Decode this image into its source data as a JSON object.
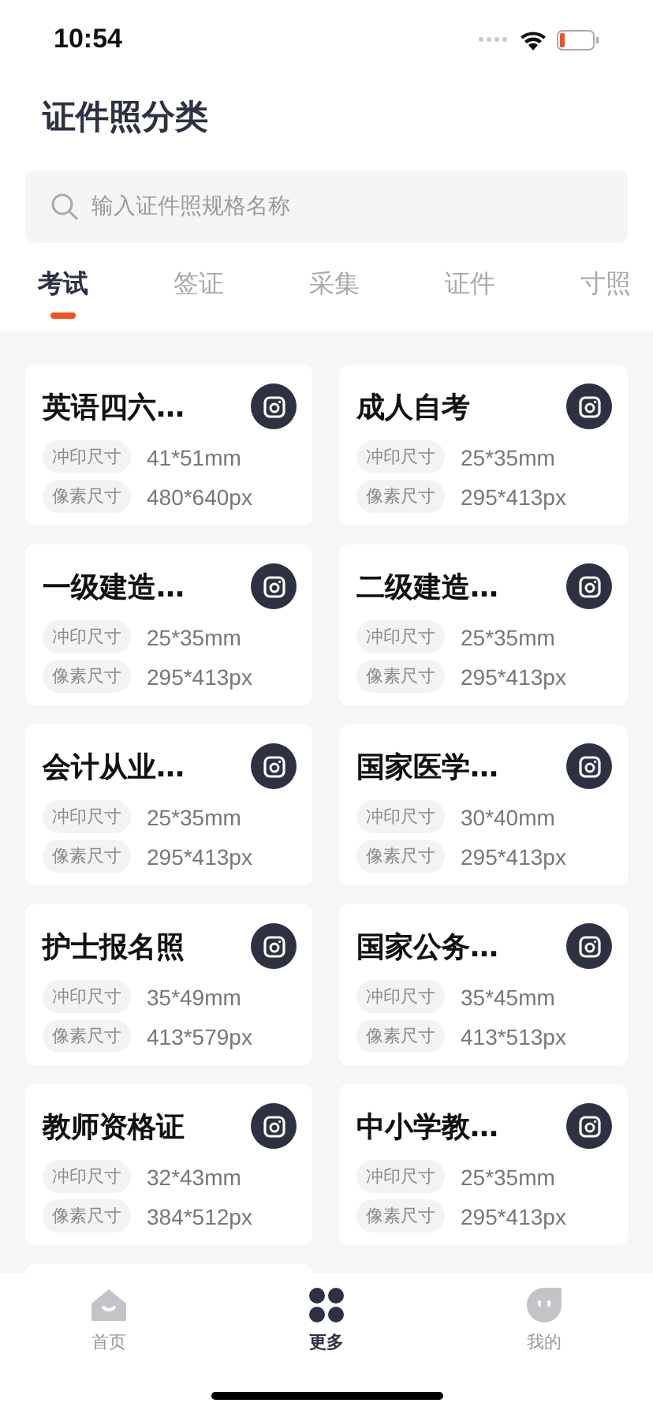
{
  "status_bar": {
    "time": "10:54"
  },
  "header": {
    "title": "证件照分类"
  },
  "search": {
    "placeholder": "输入证件照规格名称"
  },
  "tabs": [
    {
      "label": "考试",
      "selected": true
    },
    {
      "label": "签证",
      "selected": false
    },
    {
      "label": "采集",
      "selected": false
    },
    {
      "label": "证件",
      "selected": false
    },
    {
      "label": "寸照",
      "selected": false
    }
  ],
  "cards": [
    {
      "title": "英语四六…",
      "print_label": "冲印尺寸",
      "print_size": "41*51mm",
      "pixel_label": "像素尺寸",
      "pixel_size": "480*640px"
    },
    {
      "title": "成人自考",
      "print_label": "冲印尺寸",
      "print_size": "25*35mm",
      "pixel_label": "像素尺寸",
      "pixel_size": "295*413px"
    },
    {
      "title": "一级建造…",
      "print_label": "冲印尺寸",
      "print_size": "25*35mm",
      "pixel_label": "像素尺寸",
      "pixel_size": "295*413px"
    },
    {
      "title": "二级建造…",
      "print_label": "冲印尺寸",
      "print_size": "25*35mm",
      "pixel_label": "像素尺寸",
      "pixel_size": "295*413px"
    },
    {
      "title": "会计从业…",
      "print_label": "冲印尺寸",
      "print_size": "25*35mm",
      "pixel_label": "像素尺寸",
      "pixel_size": "295*413px"
    },
    {
      "title": "国家医学…",
      "print_label": "冲印尺寸",
      "print_size": "30*40mm",
      "pixel_label": "像素尺寸",
      "pixel_size": "295*413px"
    },
    {
      "title": "护士报名照",
      "print_label": "冲印尺寸",
      "print_size": "35*49mm",
      "pixel_label": "像素尺寸",
      "pixel_size": "413*579px"
    },
    {
      "title": "国家公务…",
      "print_label": "冲印尺寸",
      "print_size": "35*45mm",
      "pixel_label": "像素尺寸",
      "pixel_size": "413*513px"
    },
    {
      "title": "教师资格证",
      "print_label": "冲印尺寸",
      "print_size": "32*43mm",
      "pixel_label": "像素尺寸",
      "pixel_size": "384*512px"
    },
    {
      "title": "中小学教…",
      "print_label": "冲印尺寸",
      "print_size": "25*35mm",
      "pixel_label": "像素尺寸",
      "pixel_size": "295*413px"
    }
  ],
  "bottom_nav": [
    {
      "label": "首页",
      "kind": "home",
      "selected": false
    },
    {
      "label": "更多",
      "kind": "more",
      "selected": true
    },
    {
      "label": "我的",
      "kind": "me",
      "selected": false
    }
  ]
}
